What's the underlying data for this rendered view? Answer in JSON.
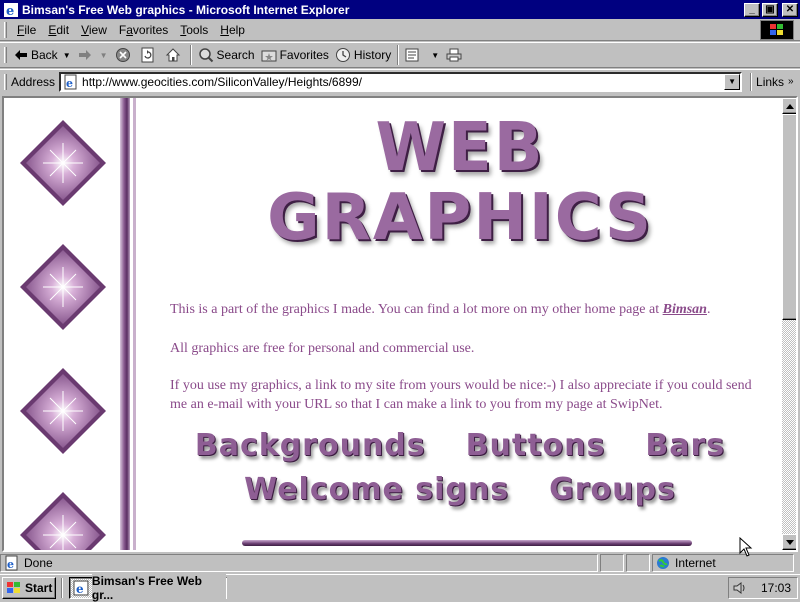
{
  "window": {
    "title": "Bimsan's Free Web graphics - Microsoft Internet Explorer",
    "buttons": {
      "minimize": "_",
      "maximize": "▣",
      "close": "✕"
    }
  },
  "menubar": {
    "items": [
      "File",
      "Edit",
      "View",
      "Favorites",
      "Tools",
      "Help"
    ],
    "underline": [
      "F",
      "E",
      "V",
      "a",
      "T",
      "H"
    ]
  },
  "toolbar": {
    "back_label": "Back",
    "search_label": "Search",
    "favorites_label": "Favorites",
    "history_label": "History"
  },
  "addressbar": {
    "label": "Address",
    "url": "http://www.geocities.com/SiliconValley/Heights/6899/",
    "links_label": "Links"
  },
  "page": {
    "heading_line1": "WEB",
    "heading_line2": "GRAPHICS",
    "p1_text": "This is a part of the graphics I made.  You can find a lot more on my other home page at ",
    "p1_link": "Bimsan",
    "p1_end": ".",
    "p2_text": "All graphics are free for personal and commercial use.",
    "p3_text": "If you use my graphics, a link to my site from yours would be nice:-) I also appreciate if you could send me an e-mail with your URL so that I can make a link to you from my page at SwipNet.",
    "nav_row1": [
      "Backgrounds",
      "Buttons",
      "Bars"
    ],
    "nav_row2": [
      "Welcome signs",
      "Groups"
    ]
  },
  "statusbar": {
    "status_text": "Done",
    "zone_text": "Internet"
  },
  "taskbar": {
    "start_label": "Start",
    "task_label": "Bimsan's Free Web gr...",
    "clock": "17:03"
  },
  "colors": {
    "titlebar": "#000080",
    "page_text": "#8a4a8a",
    "accent_purple": "#8e5e94"
  }
}
